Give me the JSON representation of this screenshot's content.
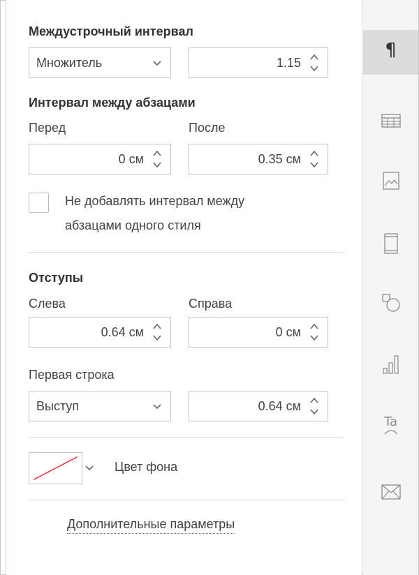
{
  "line_spacing": {
    "heading": "Междустрочный интервал",
    "mode": "Множитель",
    "value": "1.15"
  },
  "paragraph_spacing": {
    "heading": "Интервал между абзацами",
    "before_label": "Перед",
    "before_value": "0 см",
    "after_label": "После",
    "after_value": "0.35 см",
    "no_space_checkbox_label_line1": "Не добавлять интервал между",
    "no_space_checkbox_label_line2": "абзацами одного стиля",
    "no_space_checked": false
  },
  "indents": {
    "heading": "Отступы",
    "left_label": "Слева",
    "left_value": "0.64 см",
    "right_label": "Справа",
    "right_value": "0 см",
    "first_line_label": "Первая строка",
    "first_line_mode": "Выступ",
    "first_line_value": "0.64 см"
  },
  "background": {
    "label": "Цвет фона",
    "swatch": "no-fill",
    "swatch_line_color": "#e0363c"
  },
  "advanced_link": "Дополнительные параметры",
  "rail": {
    "items": [
      {
        "icon": "paragraph-icon",
        "active": true
      },
      {
        "icon": "table-icon",
        "active": false
      },
      {
        "icon": "image-icon",
        "active": false
      },
      {
        "icon": "header-footer-icon",
        "active": false
      },
      {
        "icon": "shape-icon",
        "active": false
      },
      {
        "icon": "chart-icon",
        "active": false
      },
      {
        "icon": "text-art-icon",
        "active": false
      },
      {
        "icon": "mail-merge-icon",
        "active": false
      }
    ]
  },
  "colors": {
    "active_tab_bg": "#dcdcdc",
    "rail_bg": "#f5f5f5",
    "border": "#c4c4c4",
    "icon": "#8a8a8a"
  }
}
